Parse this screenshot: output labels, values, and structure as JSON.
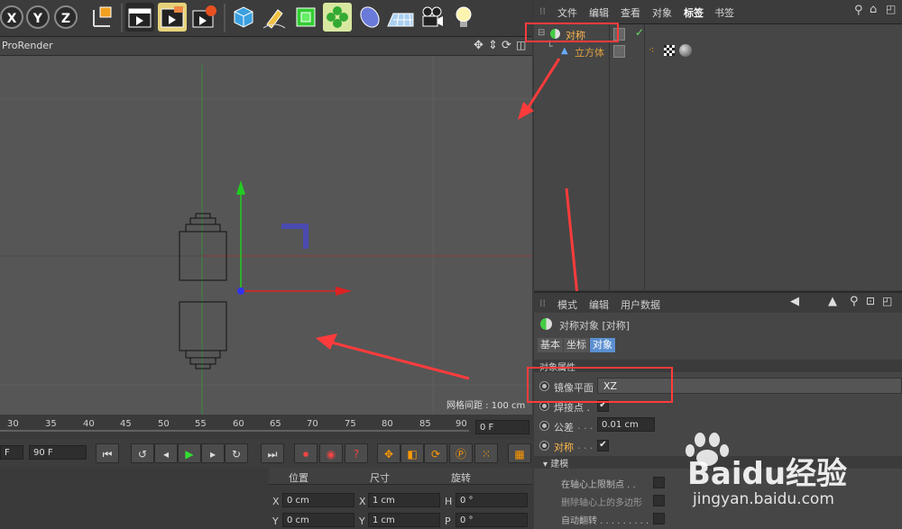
{
  "toolbar": {
    "axis_buttons": [
      "X",
      "Y",
      "Z"
    ],
    "icons": [
      "coordinate-system-icon",
      "render-view-icon",
      "render-picture-viewer-icon",
      "render-settings-icon",
      "cube-icon",
      "pen-icon",
      "subdivision-icon",
      "array-icon",
      "deformer-icon",
      "floor-icon",
      "camera-icon",
      "light-icon"
    ]
  },
  "viewport": {
    "title": "ProRender",
    "grid_label": "网格间距 : 100 cm",
    "nav_icons": [
      "move-view-icon",
      "zoom-view-icon",
      "rotate-view-icon",
      "maximize-view-icon"
    ]
  },
  "timeline": {
    "ticks": [
      "30",
      "35",
      "40",
      "45",
      "50",
      "55",
      "60",
      "65",
      "70",
      "75",
      "80",
      "85",
      "90"
    ],
    "frame_field": "0 F",
    "start_field": "F",
    "end_field": "90 F"
  },
  "coords": {
    "headers": [
      "位置",
      "尺寸",
      "旋转"
    ],
    "rows": [
      {
        "axis": "X",
        "pos": "0 cm",
        "size_axis": "X",
        "size": "1 cm",
        "rot_axis": "H",
        "rot": "0 °"
      },
      {
        "axis": "Y",
        "pos": "0 cm",
        "size_axis": "Y",
        "size": "1 cm",
        "rot_axis": "P",
        "rot": "0 °"
      }
    ]
  },
  "object_manager": {
    "menu": [
      "文件",
      "编辑",
      "查看",
      "对象",
      "标签",
      "书签"
    ],
    "objects": [
      {
        "name": "对称",
        "color": "#ffb84d"
      },
      {
        "name": "立方体",
        "color": "#e0a040"
      }
    ]
  },
  "attributes": {
    "menu": [
      "模式",
      "编辑",
      "用户数据"
    ],
    "object_title": "对称对象 [对称]",
    "tabs": [
      "基本",
      "坐标",
      "对象"
    ],
    "section": "对象属性",
    "mirror_plane_label": "镜像平面",
    "mirror_plane_value": "XZ",
    "weld_label": "焊接点 .",
    "tolerance_label": "公差",
    "tolerance_value": "0.01 cm",
    "symmetry_label": "对称",
    "modeling_section": "建模",
    "opt1": "在轴心上限制点 . .",
    "opt2": "删除轴心上的多边形",
    "opt3": "自动翻转 . . . . . . . . ."
  },
  "watermark": {
    "brand": "Baidu经验",
    "url": "jingyan.baidu.com"
  },
  "colors": {
    "accent_red": "#ff3b3b",
    "y_axis": "#22cc22",
    "x_axis": "#cc2222"
  }
}
